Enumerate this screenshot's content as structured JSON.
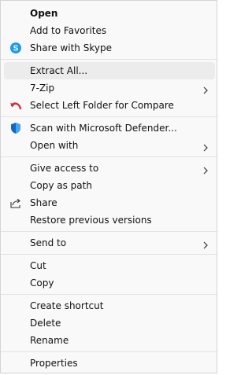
{
  "menu": {
    "items": [
      {
        "label": "Open",
        "bold": true,
        "icon": null,
        "submenu": false
      },
      {
        "label": "Add to Favorites",
        "icon": null,
        "submenu": false
      },
      {
        "label": "Share with Skype",
        "icon": "skype-icon",
        "submenu": false
      },
      {
        "label": "Extract All...",
        "icon": null,
        "submenu": false,
        "highlighted": true
      },
      {
        "label": "7-Zip",
        "icon": null,
        "submenu": true
      },
      {
        "label": "Select Left Folder for Compare",
        "icon": "compare-arrow-icon",
        "submenu": false
      },
      {
        "label": "Scan with Microsoft Defender...",
        "icon": "defender-shield-icon",
        "submenu": false
      },
      {
        "label": "Open with",
        "icon": null,
        "submenu": true
      },
      {
        "label": "Give access to",
        "icon": null,
        "submenu": true
      },
      {
        "label": "Copy as path",
        "icon": null,
        "submenu": false
      },
      {
        "label": "Share",
        "icon": "share-icon",
        "submenu": false
      },
      {
        "label": "Restore previous versions",
        "icon": null,
        "submenu": false
      },
      {
        "label": "Send to",
        "icon": null,
        "submenu": true
      },
      {
        "label": "Cut",
        "icon": null,
        "submenu": false
      },
      {
        "label": "Copy",
        "icon": null,
        "submenu": false
      },
      {
        "label": "Create shortcut",
        "icon": null,
        "submenu": false
      },
      {
        "label": "Delete",
        "icon": null,
        "submenu": false
      },
      {
        "label": "Rename",
        "icon": null,
        "submenu": false
      },
      {
        "label": "Properties",
        "icon": null,
        "submenu": false
      }
    ]
  },
  "colors": {
    "skype": "#1e9be6",
    "defender": "#1565c0",
    "compare_arrow": "#e0282f",
    "highlight": "#ececec",
    "separator": "#e3e3e3"
  }
}
